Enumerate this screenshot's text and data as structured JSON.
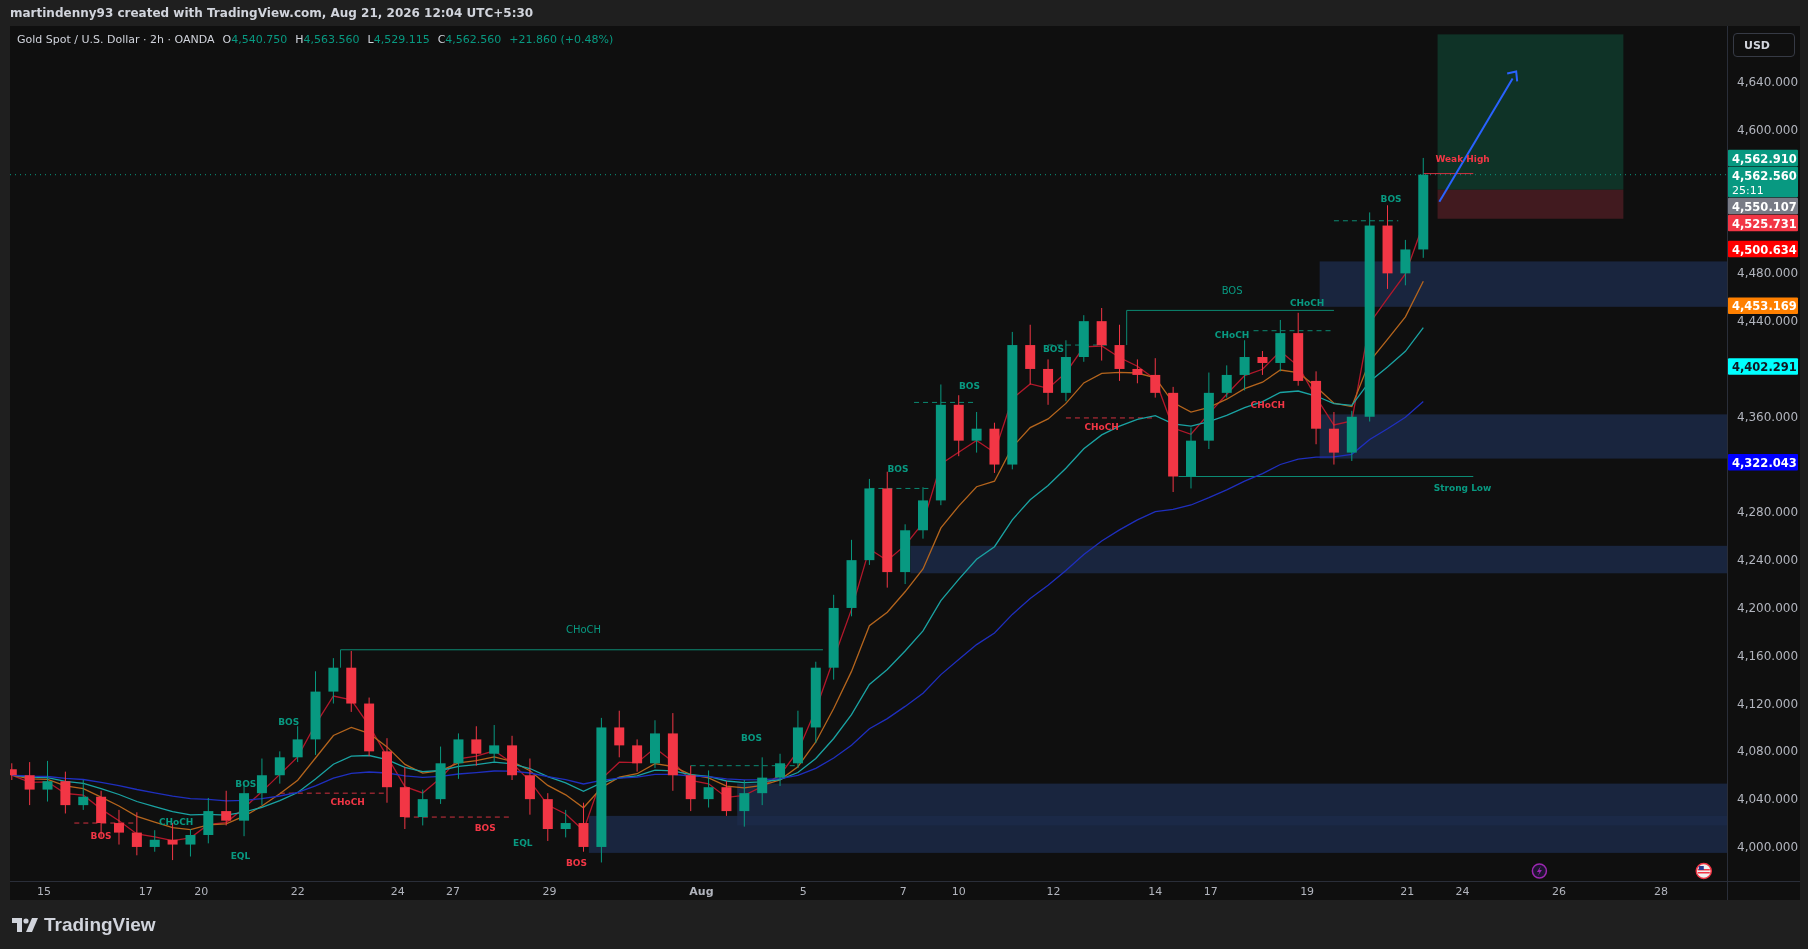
{
  "header": {
    "text": "martindenny93 created with TradingView.com, Aug 21, 2026 12:04 UTC+5:30"
  },
  "legend": {
    "symbol": "Gold Spot / U.S. Dollar · 2h · OANDA",
    "ohlc": [
      {
        "key": "O",
        "value": "4,540.750"
      },
      {
        "key": "H",
        "value": "4,563.560"
      },
      {
        "key": "L",
        "value": "4,529.115"
      },
      {
        "key": "C",
        "value": "4,562.560"
      }
    ],
    "change": "+21.860 (+0.48%)"
  },
  "currency_button": "USD",
  "price_axis": [
    "4,640.000",
    "4,600.000",
    "4,480.000",
    "4,440.000",
    "4,360.000",
    "4,280.000",
    "4,240.000",
    "4,200.000",
    "4,160.000",
    "4,120.000",
    "4,080.000",
    "4,040.000",
    "4,000.000"
  ],
  "time_axis": [
    "15",
    "17",
    "20",
    "22",
    "24",
    "27",
    "29",
    "Aug",
    "5",
    "7",
    "10",
    "12",
    "14",
    "17",
    "19",
    "21",
    "24",
    "26",
    "28"
  ],
  "chart_labels": [
    {
      "text": "CHoCH",
      "color": "#089981"
    },
    {
      "text": "BOS",
      "color": "#089981"
    },
    {
      "text": "CHoCH",
      "color": "#089981"
    },
    {
      "text": "CHoCH",
      "color": "#089981"
    },
    {
      "text": "CHoCH",
      "color": "#f23645"
    },
    {
      "text": "CHoCH",
      "color": "#f23645"
    },
    {
      "text": "BOS",
      "color": "#089981"
    },
    {
      "text": "BOS",
      "color": "#089981"
    },
    {
      "text": "BOS",
      "color": "#089981"
    },
    {
      "text": "BOS",
      "color": "#089981"
    },
    {
      "text": "Weak High",
      "color": "#f23645"
    },
    {
      "text": "Strong Low",
      "color": "#089981"
    },
    {
      "text": "BOS",
      "color": "#089981"
    },
    {
      "text": "BOS",
      "color": "#089981"
    },
    {
      "text": "BOS",
      "color": "#089981"
    },
    {
      "text": "CHoCH",
      "color": "#089981"
    },
    {
      "text": "BOS",
      "color": "#f23645"
    },
    {
      "text": "CHoCH",
      "color": "#f23645"
    },
    {
      "text": "BOS",
      "color": "#f23645"
    },
    {
      "text": "EQL",
      "color": "#089981"
    },
    {
      "text": "BOS",
      "color": "#f23645"
    },
    {
      "text": "EQL",
      "color": "#089981"
    }
  ],
  "price_labels": [
    {
      "text": "4,562.910",
      "color": "#089981"
    },
    {
      "text": "4,562.560",
      "color": "#089981",
      "countdown": "25:11"
    },
    {
      "text": "4,550.107",
      "color": "#787b86"
    },
    {
      "text": "4,525.731",
      "color": "#f23645"
    },
    {
      "text": "4,500.634",
      "color": "#ff0000"
    },
    {
      "text": "4,453.169",
      "color": "#ff8000"
    },
    {
      "text": "4,402.291",
      "color": "#00ffff"
    },
    {
      "text": "4,322.043",
      "color": "#0000ff"
    }
  ],
  "footer": {
    "logo": "TradingView"
  }
}
